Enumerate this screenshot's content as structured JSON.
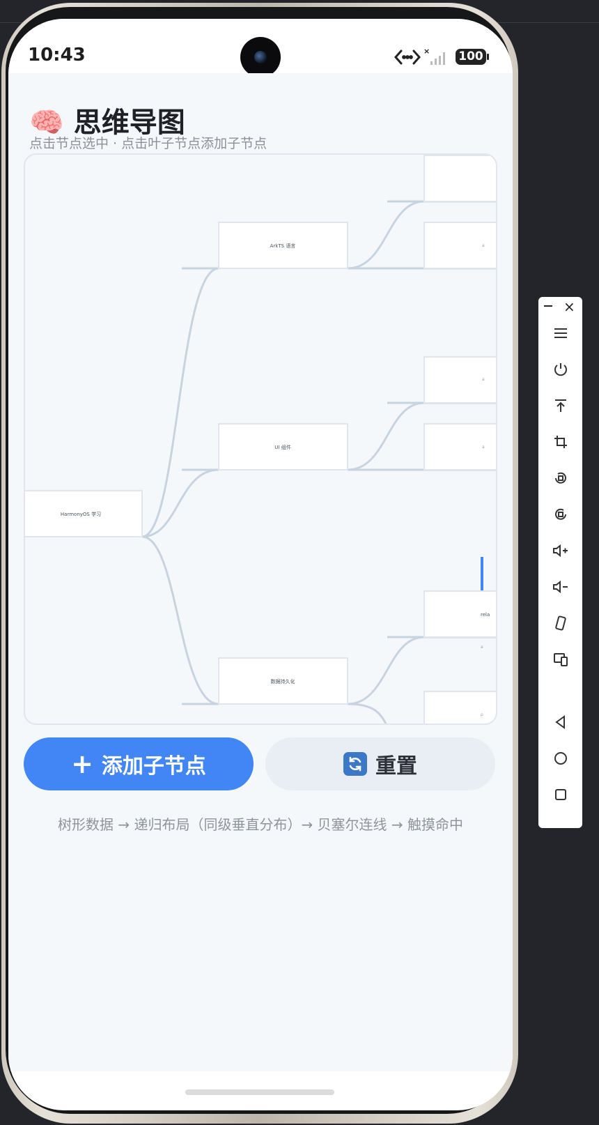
{
  "status_bar": {
    "time": "10:43",
    "battery": "100"
  },
  "app": {
    "title_emoji": "🧠",
    "title": "思维导图",
    "subtitle": "点击节点选中 · 点击叶子节点添加子节点",
    "add_button_label": "添加子节点",
    "reset_button_label": "重置",
    "footer_note": "树形数据 → 递归布局（同级垂直分布）→ 贝塞尔连线 → 触摸命中"
  },
  "mindmap": {
    "root": "HarmonyOS 学习",
    "branches": [
      "ArkTS 语言",
      "UI 组件",
      "数据持久化"
    ],
    "partial_labels": [
      "rela"
    ]
  },
  "toolbar": {
    "icons": [
      "menu-icon",
      "power-icon",
      "pin-top-icon",
      "crop-icon",
      "rotate-left-icon",
      "rotate-right-icon",
      "volume-up-icon",
      "volume-down-icon",
      "shake-icon",
      "multi-device-icon",
      "back-icon",
      "home-icon",
      "recents-icon"
    ]
  }
}
